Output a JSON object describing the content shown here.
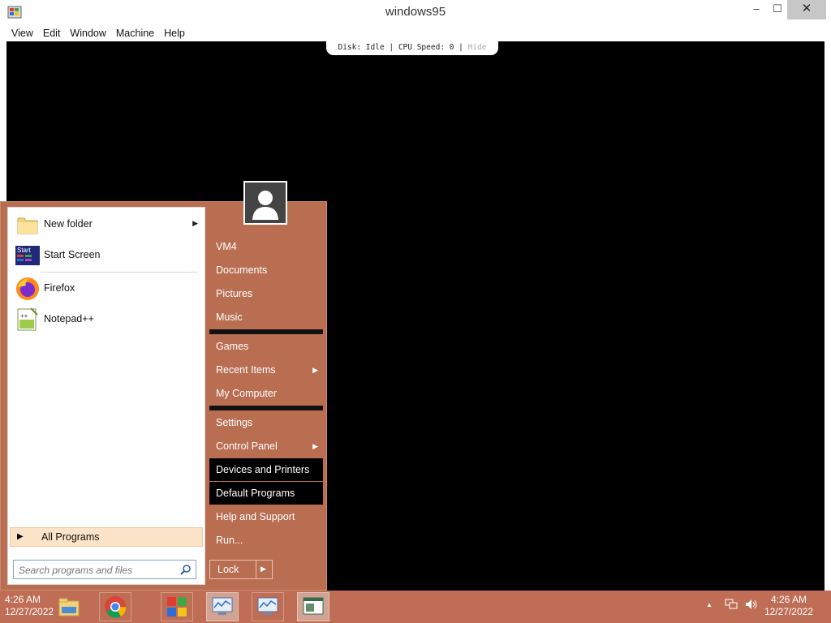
{
  "window": {
    "title": "windows95",
    "menu": [
      "View",
      "Edit",
      "Window",
      "Machine",
      "Help"
    ],
    "controls": {
      "minimize": "‒",
      "maximize": "☐",
      "close": "✕"
    }
  },
  "status": {
    "text": "Disk: Idle | CPU Speed: 0 |",
    "hide": "Hide"
  },
  "start_menu": {
    "left_items": [
      {
        "label": "New folder",
        "icon": "folder-icon",
        "has_submenu": true
      },
      {
        "label": "Start Screen",
        "icon": "start-screen-icon",
        "icon_text": "Start"
      },
      {
        "label": "Firefox",
        "icon": "firefox-icon"
      },
      {
        "label": "Notepad++",
        "icon": "notepad-plus-plus-icon"
      }
    ],
    "all_programs": "All Programs",
    "search_placeholder": "Search programs and files",
    "right_items": [
      {
        "label": "VM4"
      },
      {
        "label": "Documents"
      },
      {
        "label": "Pictures"
      },
      {
        "label": "Music"
      },
      {
        "label": "Games"
      },
      {
        "label": "Recent Items",
        "has_submenu": true
      },
      {
        "label": "My Computer"
      },
      {
        "label": "Settings"
      },
      {
        "label": "Control Panel",
        "has_submenu": true
      },
      {
        "label": "Devices and Printers",
        "highlighted": true
      },
      {
        "label": "Default Programs",
        "highlighted": true
      },
      {
        "label": "Help and Support"
      },
      {
        "label": "Run..."
      }
    ],
    "lock": "Lock"
  },
  "taskbar": {
    "left_clock": {
      "time": "4:26 AM",
      "date": "12/27/2022"
    },
    "right_clock": {
      "time": "4:26 AM",
      "date": "12/27/2022"
    },
    "tray_up": "▲"
  },
  "colors": {
    "accent": "#bf6d55",
    "startmenu_bg": "#b96e52",
    "highlight": "#000000"
  }
}
